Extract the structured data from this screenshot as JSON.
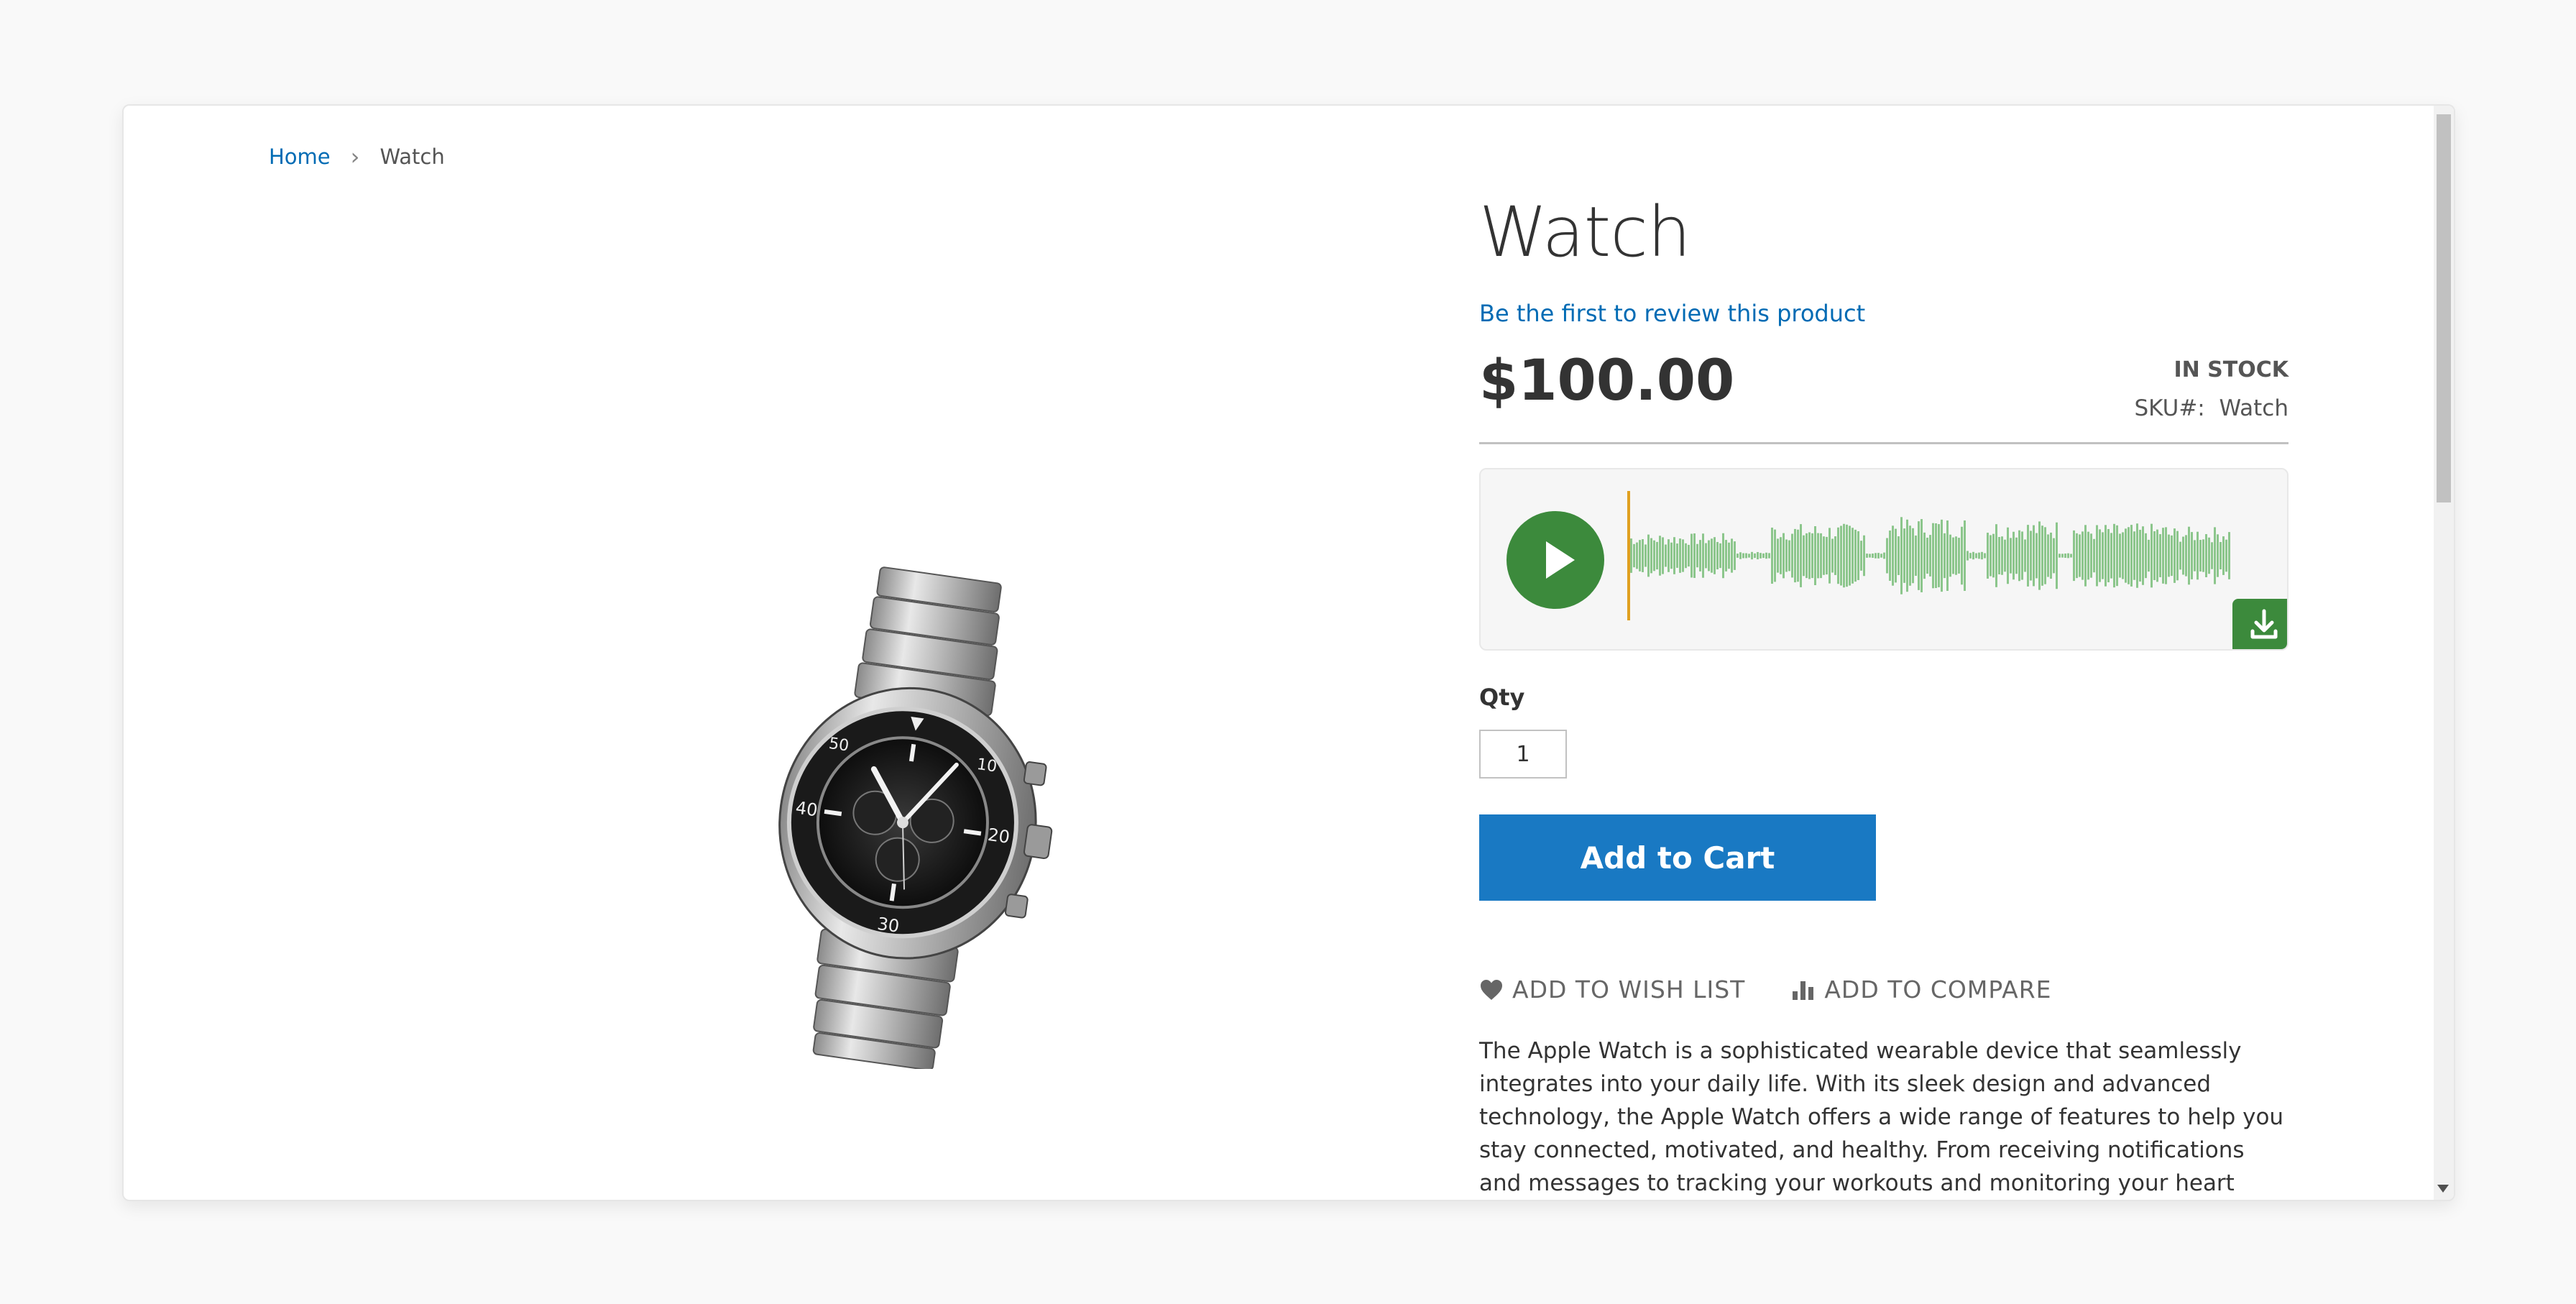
{
  "breadcrumb": {
    "home": "Home",
    "separator": "›",
    "current": "Watch"
  },
  "product": {
    "title": "Watch",
    "review_link": "Be the first to review this product",
    "price": "$100.00",
    "stock": "IN STOCK",
    "sku_label": "SKU#:",
    "sku_value": "Watch",
    "image_alt": "silver-chronograph-watch",
    "description": "The Apple Watch is a sophisticated wearable device that seamlessly integrates into your daily life. With its sleek design and advanced technology, the Apple Watch offers a wide range of features to help you stay connected, motivated, and healthy. From receiving notifications and messages to tracking your workouts and monitoring your heart rate, the"
  },
  "player": {
    "play_icon": "play-icon",
    "download_icon": "download-icon",
    "accent_color": "#3c8a3c",
    "wave_color": "#8cc68c",
    "cursor_color": "#e0a020"
  },
  "purchase": {
    "qty_label": "Qty",
    "qty_value": "1",
    "add_to_cart": "Add to Cart"
  },
  "actions": {
    "wishlist": "Add to Wish List",
    "compare": "Add to Compare"
  },
  "colors": {
    "link": "#006bb4",
    "button": "#1979c3"
  }
}
